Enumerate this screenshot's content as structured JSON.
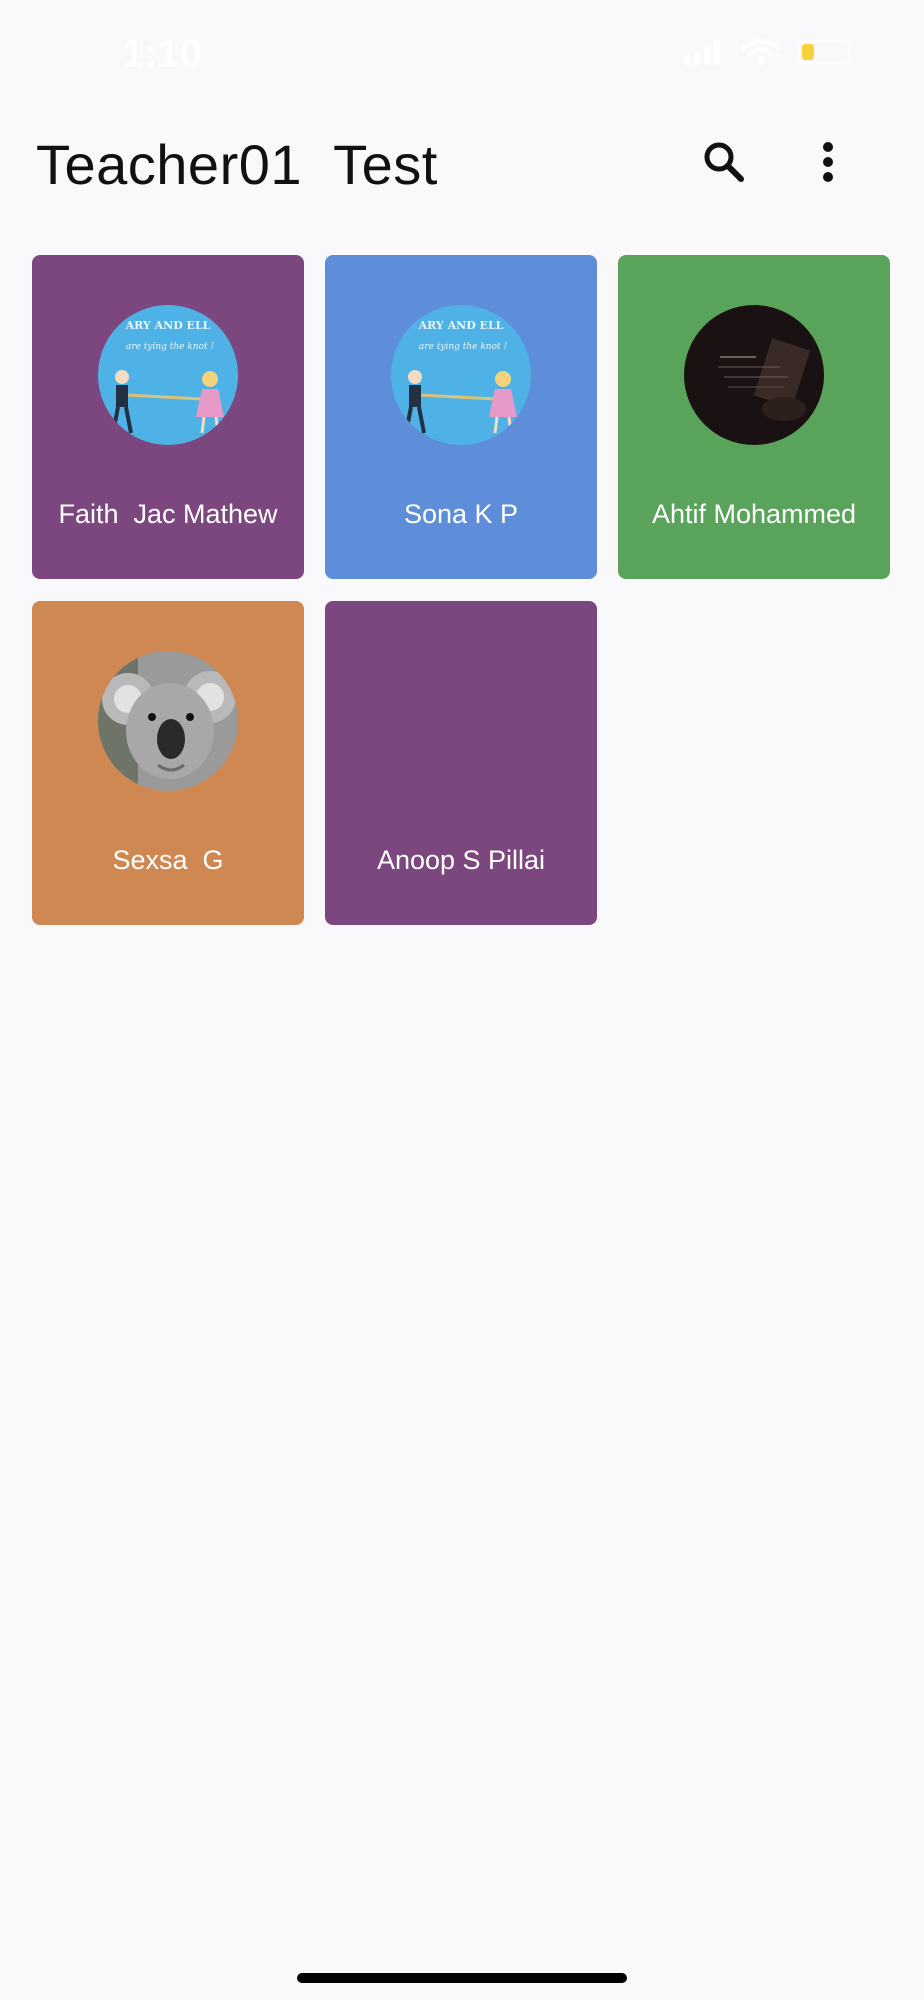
{
  "status_bar": {
    "time": "1:10",
    "icons": [
      "signal-icon",
      "wifi-icon",
      "battery-icon"
    ],
    "battery_color": "#f6d33c"
  },
  "header": {
    "title": "Teacher01  Test",
    "actions": [
      "search-icon",
      "more-vertical-icon"
    ]
  },
  "students": [
    {
      "name": "Faith  Jac Mathew",
      "color": "#7b477e",
      "avatar": "cartoon-couple-avatar",
      "avatar_bg": "#4fb2e6"
    },
    {
      "name": "Sona K P",
      "color": "#5e8dd9",
      "avatar": "cartoon-couple-avatar",
      "avatar_bg": "#4fb2e6"
    },
    {
      "name": "Ahtif Mohammed",
      "color": "#5aa35a",
      "avatar": "dark-photo-avatar",
      "avatar_bg": "#1a1212"
    },
    {
      "name": "Sexsa  G",
      "color": "#d08853",
      "avatar": "koala-avatar",
      "avatar_bg": "#9a9a9a"
    },
    {
      "name": "Anoop S Pillai",
      "color": "#7b477e",
      "avatar": "",
      "avatar_bg": ""
    }
  ]
}
